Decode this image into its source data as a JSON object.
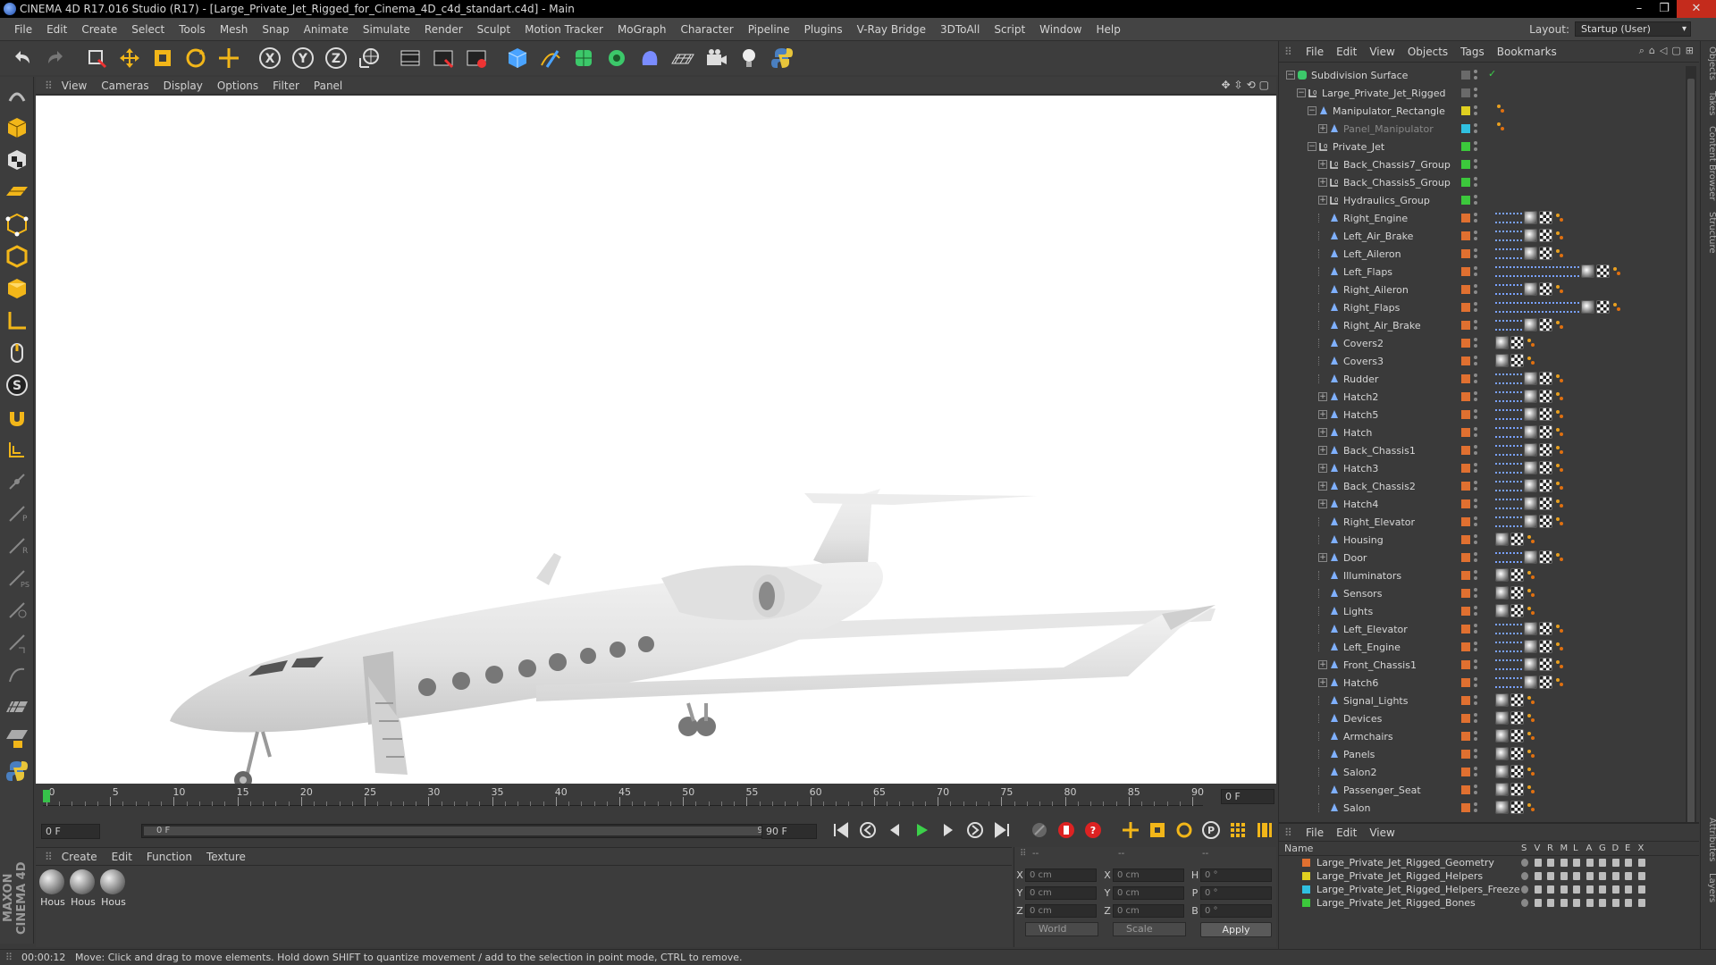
{
  "window": {
    "title": "CINEMA 4D R17.016 Studio (R17) - [Large_Private_Jet_Rigged_for_Cinema_4D_c4d_standart.c4d] - Main"
  },
  "menubar": [
    "File",
    "Edit",
    "Create",
    "Select",
    "Tools",
    "Mesh",
    "Snap",
    "Animate",
    "Simulate",
    "Render",
    "Sculpt",
    "Motion Tracker",
    "MoGraph",
    "Character",
    "Pipeline",
    "Plugins",
    "V-Ray Bridge",
    "3DToAll",
    "Script",
    "Window",
    "Help"
  ],
  "layout": {
    "label": "Layout:",
    "value": "Startup (User)"
  },
  "viewport_menu": [
    "View",
    "Cameras",
    "Display",
    "Options",
    "Filter",
    "Panel"
  ],
  "timeline": {
    "ticks": [
      "0",
      "5",
      "10",
      "15",
      "20",
      "25",
      "30",
      "35",
      "40",
      "45",
      "50",
      "55",
      "60",
      "65",
      "70",
      "75",
      "80",
      "85",
      "90"
    ],
    "current_frame_right": "0 F",
    "start_field": "0 F",
    "range_start": "0 F",
    "range_end": "90 F",
    "end_field": "90 F"
  },
  "material_menu": [
    "Create",
    "Edit",
    "Function",
    "Texture"
  ],
  "materials": [
    "Hous",
    "Hous",
    "Hous"
  ],
  "coordinates": {
    "headers": [
      "--",
      "--",
      "--"
    ],
    "rows": [
      {
        "a": "X",
        "av": "0 cm",
        "b": "X",
        "bv": "0 cm",
        "c": "H",
        "cv": "0 °"
      },
      {
        "a": "Y",
        "av": "0 cm",
        "b": "Y",
        "bv": "0 cm",
        "c": "P",
        "cv": "0 °"
      },
      {
        "a": "Z",
        "av": "0 cm",
        "b": "Z",
        "bv": "0 cm",
        "c": "B",
        "cv": "0 °"
      }
    ],
    "mode1": "World",
    "mode2": "Scale",
    "apply": "Apply"
  },
  "status": {
    "time": "00:00:12",
    "message": "Move: Click and drag to move elements. Hold down SHIFT to quantize movement / add to the selection in point mode, CTRL to remove."
  },
  "object_manager": {
    "menu": [
      "File",
      "Edit",
      "View",
      "Objects",
      "Tags",
      "Bookmarks"
    ],
    "objects": [
      {
        "name": "Subdivision Surface",
        "indent": 0,
        "exp": "-",
        "icon": "subdiv",
        "color": "#6a6a6a",
        "tags": "check"
      },
      {
        "name": "Large_Private_Jet_Rigged",
        "indent": 1,
        "exp": "-",
        "icon": "null",
        "color": "#6a6a6a",
        "tags": ""
      },
      {
        "name": "Manipulator_Rectangle",
        "indent": 2,
        "exp": "-",
        "icon": "joint",
        "color": "#e0d020",
        "tags": "xp"
      },
      {
        "name": "Panel_Manipulator",
        "indent": 3,
        "exp": "+",
        "icon": "joint",
        "color": "#30c0e0",
        "tags": "xp",
        "dim": true
      },
      {
        "name": "Private_Jet",
        "indent": 2,
        "exp": "-",
        "icon": "null",
        "color": "#3cc83c",
        "tags": ""
      },
      {
        "name": "Back_Chassis7_Group",
        "indent": 3,
        "exp": "+",
        "icon": "null",
        "color": "#3cc83c",
        "tags": ""
      },
      {
        "name": "Back_Chassis5_Group",
        "indent": 3,
        "exp": "+",
        "icon": "null",
        "color": "#3cc83c",
        "tags": ""
      },
      {
        "name": "Hydraulics_Group",
        "indent": 3,
        "exp": "+",
        "icon": "null",
        "color": "#3cc83c",
        "tags": ""
      },
      {
        "name": "Right_Engine",
        "indent": 3,
        "exp": "",
        "icon": "joint",
        "color": "#e07030",
        "tags": "ik"
      },
      {
        "name": "Left_Air_Brake",
        "indent": 3,
        "exp": "",
        "icon": "joint",
        "color": "#e07030",
        "tags": "ik"
      },
      {
        "name": "Left_Aileron",
        "indent": 3,
        "exp": "",
        "icon": "joint",
        "color": "#e07030",
        "tags": "ik"
      },
      {
        "name": "Left_Flaps",
        "indent": 3,
        "exp": "",
        "icon": "joint",
        "color": "#e07030",
        "tags": "ik2"
      },
      {
        "name": "Right_Aileron",
        "indent": 3,
        "exp": "",
        "icon": "joint",
        "color": "#e07030",
        "tags": "ik"
      },
      {
        "name": "Right_Flaps",
        "indent": 3,
        "exp": "",
        "icon": "joint",
        "color": "#e07030",
        "tags": "ik2"
      },
      {
        "name": "Right_Air_Brake",
        "indent": 3,
        "exp": "",
        "icon": "joint",
        "color": "#e07030",
        "tags": "ik"
      },
      {
        "name": "Covers2",
        "indent": 3,
        "exp": "",
        "icon": "joint",
        "color": "#e07030",
        "tags": "plain"
      },
      {
        "name": "Covers3",
        "indent": 3,
        "exp": "",
        "icon": "joint",
        "color": "#e07030",
        "tags": "plain"
      },
      {
        "name": "Rudder",
        "indent": 3,
        "exp": "",
        "icon": "joint",
        "color": "#e07030",
        "tags": "ik"
      },
      {
        "name": "Hatch2",
        "indent": 3,
        "exp": "+",
        "icon": "joint",
        "color": "#e07030",
        "tags": "ik"
      },
      {
        "name": "Hatch5",
        "indent": 3,
        "exp": "+",
        "icon": "joint",
        "color": "#e07030",
        "tags": "ik"
      },
      {
        "name": "Hatch",
        "indent": 3,
        "exp": "+",
        "icon": "joint",
        "color": "#e07030",
        "tags": "ik"
      },
      {
        "name": "Back_Chassis1",
        "indent": 3,
        "exp": "+",
        "icon": "joint",
        "color": "#e07030",
        "tags": "ik"
      },
      {
        "name": "Hatch3",
        "indent": 3,
        "exp": "+",
        "icon": "joint",
        "color": "#e07030",
        "tags": "ik"
      },
      {
        "name": "Back_Chassis2",
        "indent": 3,
        "exp": "+",
        "icon": "joint",
        "color": "#e07030",
        "tags": "ik"
      },
      {
        "name": "Hatch4",
        "indent": 3,
        "exp": "+",
        "icon": "joint",
        "color": "#e07030",
        "tags": "ik"
      },
      {
        "name": "Right_Elevator",
        "indent": 3,
        "exp": "",
        "icon": "joint",
        "color": "#e07030",
        "tags": "ik"
      },
      {
        "name": "Housing",
        "indent": 3,
        "exp": "",
        "icon": "joint",
        "color": "#e07030",
        "tags": "plain"
      },
      {
        "name": "Door",
        "indent": 3,
        "exp": "+",
        "icon": "joint",
        "color": "#e07030",
        "tags": "ik"
      },
      {
        "name": "Illuminators",
        "indent": 3,
        "exp": "",
        "icon": "joint",
        "color": "#e07030",
        "tags": "plain"
      },
      {
        "name": "Sensors",
        "indent": 3,
        "exp": "",
        "icon": "joint",
        "color": "#e07030",
        "tags": "plain"
      },
      {
        "name": "Lights",
        "indent": 3,
        "exp": "",
        "icon": "joint",
        "color": "#e07030",
        "tags": "plain"
      },
      {
        "name": "Left_Elevator",
        "indent": 3,
        "exp": "",
        "icon": "joint",
        "color": "#e07030",
        "tags": "ik"
      },
      {
        "name": "Left_Engine",
        "indent": 3,
        "exp": "",
        "icon": "joint",
        "color": "#e07030",
        "tags": "ik"
      },
      {
        "name": "Front_Chassis1",
        "indent": 3,
        "exp": "+",
        "icon": "joint",
        "color": "#e07030",
        "tags": "ik"
      },
      {
        "name": "Hatch6",
        "indent": 3,
        "exp": "+",
        "icon": "joint",
        "color": "#e07030",
        "tags": "ik"
      },
      {
        "name": "Signal_Lights",
        "indent": 3,
        "exp": "",
        "icon": "joint",
        "color": "#e07030",
        "tags": "plain"
      },
      {
        "name": "Devices",
        "indent": 3,
        "exp": "",
        "icon": "joint",
        "color": "#e07030",
        "tags": "plain"
      },
      {
        "name": "Armchairs",
        "indent": 3,
        "exp": "",
        "icon": "joint",
        "color": "#e07030",
        "tags": "plain"
      },
      {
        "name": "Panels",
        "indent": 3,
        "exp": "",
        "icon": "joint",
        "color": "#e07030",
        "tags": "plain"
      },
      {
        "name": "Salon2",
        "indent": 3,
        "exp": "",
        "icon": "joint",
        "color": "#e07030",
        "tags": "plain"
      },
      {
        "name": "Passenger_Seat",
        "indent": 3,
        "exp": "",
        "icon": "joint",
        "color": "#e07030",
        "tags": "plain"
      },
      {
        "name": "Salon",
        "indent": 3,
        "exp": "",
        "icon": "joint",
        "color": "#e07030",
        "tags": "plain"
      }
    ]
  },
  "layer_manager": {
    "menu": [
      "File",
      "Edit",
      "View"
    ],
    "name_header": "Name",
    "flags": [
      "S",
      "V",
      "R",
      "M",
      "L",
      "A",
      "G",
      "D",
      "E",
      "X"
    ],
    "layers": [
      {
        "name": "Large_Private_Jet_Rigged_Geometry",
        "color": "#e07030"
      },
      {
        "name": "Large_Private_Jet_Rigged_Helpers",
        "color": "#e0d020"
      },
      {
        "name": "Large_Private_Jet_Rigged_Helpers_Freeze",
        "color": "#30c0e0"
      },
      {
        "name": "Large_Private_Jet_Rigged_Bones",
        "color": "#3cc83c"
      }
    ]
  },
  "side_tabs": [
    "Objects",
    "Takes",
    "Content Browser",
    "Structure",
    "Attributes",
    "Layers"
  ]
}
